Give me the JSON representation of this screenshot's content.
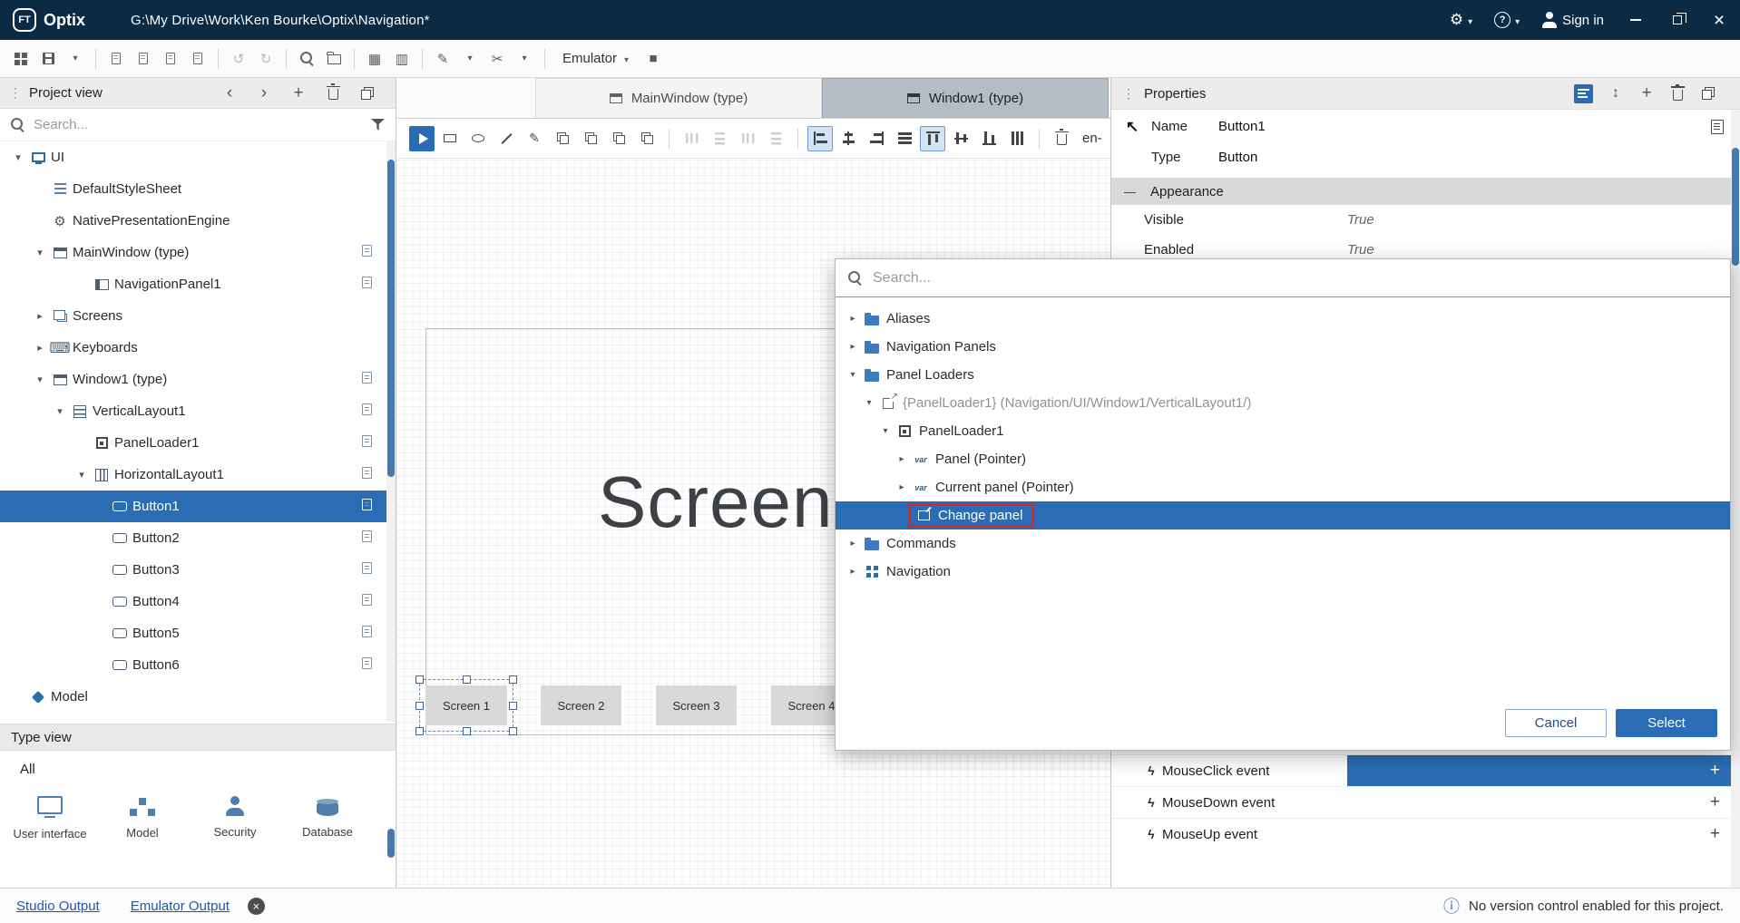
{
  "colors": {
    "titlebar_bg": "#0b2b45",
    "accent_blue": "#2a6db5",
    "annotation_red": "#e0241b"
  },
  "titlebar": {
    "logo_text": "FT",
    "app_name": "Optix",
    "path": "G:\\My Drive\\Work\\Ken Bourke\\Optix\\Navigation*",
    "sign_in_label": "Sign in"
  },
  "main_toolbar": {
    "emulator_label": "Emulator",
    "items": [
      {
        "name": "app-window-icon"
      },
      {
        "name": "save-icon"
      },
      {
        "name": "chevron-down-icon"
      },
      {
        "name": "separator"
      },
      {
        "name": "new-page-icon"
      },
      {
        "name": "open-page-icon"
      },
      {
        "name": "sync-icon"
      },
      {
        "name": "export-page-icon"
      },
      {
        "name": "separator"
      },
      {
        "name": "undo-icon",
        "disabled": true
      },
      {
        "name": "redo-icon",
        "disabled": true
      },
      {
        "name": "separator"
      },
      {
        "name": "search-icon"
      },
      {
        "name": "open-folder-icon"
      },
      {
        "name": "separator"
      },
      {
        "name": "grid-view-icon"
      },
      {
        "name": "column-view-icon"
      },
      {
        "name": "separator"
      },
      {
        "name": "pen-tool-icon"
      },
      {
        "name": "chevron-down-icon"
      },
      {
        "name": "scissors-icon"
      },
      {
        "name": "chevron-down-icon"
      },
      {
        "name": "separator"
      },
      {
        "name": "emulator-dropdown"
      },
      {
        "name": "stop-icon"
      }
    ]
  },
  "project_view": {
    "title": "Project view",
    "search_placeholder": "Search...",
    "tree": [
      {
        "label": "UI",
        "icon": "ui-monitor-icon",
        "arrow": "open",
        "level": 0
      },
      {
        "label": "DefaultStyleSheet",
        "icon": "stylesheet-icon",
        "arrow": "none",
        "level": 1
      },
      {
        "label": "NativePresentationEngine",
        "icon": "engine-icon",
        "arrow": "none",
        "level": 1
      },
      {
        "label": "MainWindow (type)",
        "icon": "window-icon",
        "arrow": "open",
        "level": 1,
        "right_icon": true
      },
      {
        "label": "NavigationPanel1",
        "icon": "navigation-panel-icon",
        "arrow": "none",
        "level": 3,
        "right_icon": true
      },
      {
        "label": "Screens",
        "icon": "screens-icon",
        "arrow": "closed",
        "level": 1
      },
      {
        "label": "Keyboards",
        "icon": "keyboard-icon",
        "arrow": "closed",
        "level": 1
      },
      {
        "label": "Window1 (type)",
        "icon": "window-icon",
        "arrow": "open",
        "level": 1,
        "right_icon": true
      },
      {
        "label": "VerticalLayout1",
        "icon": "vertical-layout-icon",
        "arrow": "open",
        "level": 2,
        "right_icon": true
      },
      {
        "label": "PanelLoader1",
        "icon": "panel-loader-icon",
        "arrow": "none",
        "level": 3,
        "right_icon": true
      },
      {
        "label": "HorizontalLayout1",
        "icon": "horizontal-layout-icon",
        "arrow": "open",
        "level": 3,
        "right_icon": true
      },
      {
        "label": "Button1",
        "icon": "button-icon",
        "arrow": "none",
        "level": 4,
        "right_icon": true,
        "selected": true
      },
      {
        "label": "Button2",
        "icon": "button-icon",
        "arrow": "none",
        "level": 4,
        "right_icon": true
      },
      {
        "label": "Button3",
        "icon": "button-icon",
        "arrow": "none",
        "level": 4,
        "right_icon": true
      },
      {
        "label": "Button4",
        "icon": "button-icon",
        "arrow": "none",
        "level": 4,
        "right_icon": true
      },
      {
        "label": "Button5",
        "icon": "button-icon",
        "arrow": "none",
        "level": 4,
        "right_icon": true
      },
      {
        "label": "Button6",
        "icon": "button-icon",
        "arrow": "none",
        "level": 4,
        "right_icon": true
      },
      {
        "label": "Model",
        "icon": "model-icon",
        "arrow": "none",
        "level": 0
      }
    ],
    "type_view_title": "Type view",
    "all_label": "All",
    "categories": [
      {
        "label": "User interface",
        "icon": "user-interface-icon"
      },
      {
        "label": "Model",
        "icon": "model-category-icon"
      },
      {
        "label": "Security",
        "icon": "security-icon"
      },
      {
        "label": "Database",
        "icon": "database-icon"
      }
    ]
  },
  "editor": {
    "tabs": [
      {
        "label": "MainWindow (type)",
        "active": false
      },
      {
        "label": "Window1 (type)",
        "active": true
      }
    ],
    "canvas_text": "Screen",
    "screen_buttons": [
      "Screen 1",
      "Screen 2",
      "Screen 3",
      "Screen 4"
    ]
  },
  "design_toolbar": {
    "language_label": "en-",
    "items": [
      {
        "name": "play-icon",
        "primary": true
      },
      {
        "name": "rectangle-icon"
      },
      {
        "name": "ellipse-icon"
      },
      {
        "name": "line-icon"
      },
      {
        "name": "pen-tool-icon"
      },
      {
        "name": "group-icon"
      },
      {
        "name": "duplicate-icon"
      },
      {
        "name": "bring-forward-icon"
      },
      {
        "name": "send-backward-icon"
      },
      {
        "name": "separator"
      },
      {
        "name": "space-horizontal-icon",
        "disabled": true
      },
      {
        "name": "space-vertical-icon",
        "disabled": true
      },
      {
        "name": "distribute-horizontal-icon",
        "disabled": true
      },
      {
        "name": "distribute-vertical-icon",
        "disabled": true
      },
      {
        "name": "separator"
      },
      {
        "name": "align-left-icon",
        "active": true
      },
      {
        "name": "align-center-icon"
      },
      {
        "name": "align-right-icon"
      },
      {
        "name": "align-justify-icon"
      },
      {
        "name": "align-top-icon",
        "active": true
      },
      {
        "name": "align-middle-icon"
      },
      {
        "name": "align-bottom-icon"
      },
      {
        "name": "align-stretch-icon"
      },
      {
        "name": "separator"
      },
      {
        "name": "delete-icon"
      }
    ]
  },
  "properties": {
    "title": "Properties",
    "name_label": "Name",
    "name_value": "Button1",
    "type_label": "Type",
    "type_value": "Button",
    "section_appearance": "Appearance",
    "rows": [
      {
        "label": "Visible",
        "value": "True"
      },
      {
        "label": "Enabled",
        "value": "True"
      }
    ],
    "events": [
      {
        "label": "MouseClick event",
        "selected": true
      },
      {
        "label": "MouseDown event",
        "selected": false
      },
      {
        "label": "MouseUp event",
        "selected": false
      }
    ]
  },
  "popup": {
    "search_placeholder": "Search...",
    "tree": [
      {
        "label": "Aliases",
        "icon": "folder-icon",
        "arrow": "closed",
        "level": 0
      },
      {
        "label": "Navigation Panels",
        "icon": "folder-icon",
        "arrow": "closed",
        "level": 0
      },
      {
        "label": "Panel Loaders",
        "icon": "folder-icon",
        "arrow": "open",
        "level": 0
      },
      {
        "label": "{PanelLoader1} (Navigation/UI/Window1/VerticalLayout1/)",
        "icon": "external-link-icon",
        "arrow": "open",
        "level": 1,
        "dim": true
      },
      {
        "label": "PanelLoader1",
        "icon": "panel-loader-icon",
        "arrow": "open",
        "level": 2
      },
      {
        "label": "Panel (Pointer)",
        "icon": "var-icon",
        "arrow": "closed",
        "level": 3
      },
      {
        "label": "Current panel (Pointer)",
        "icon": "var-icon",
        "arrow": "closed",
        "level": 3
      },
      {
        "label": "Change panel",
        "icon": "change-panel-icon",
        "arrow": "none",
        "level": 3,
        "selected": true,
        "annotated": true
      },
      {
        "label": "Commands",
        "icon": "folder-icon",
        "arrow": "closed",
        "level": 0
      },
      {
        "label": "Navigation",
        "icon": "navigation-grid-icon",
        "arrow": "closed",
        "level": 0
      }
    ],
    "cancel_label": "Cancel",
    "select_label": "Select"
  },
  "statusbar": {
    "tabs": [
      "Studio Output",
      "Emulator Output"
    ],
    "message": "No version control enabled for this project."
  }
}
